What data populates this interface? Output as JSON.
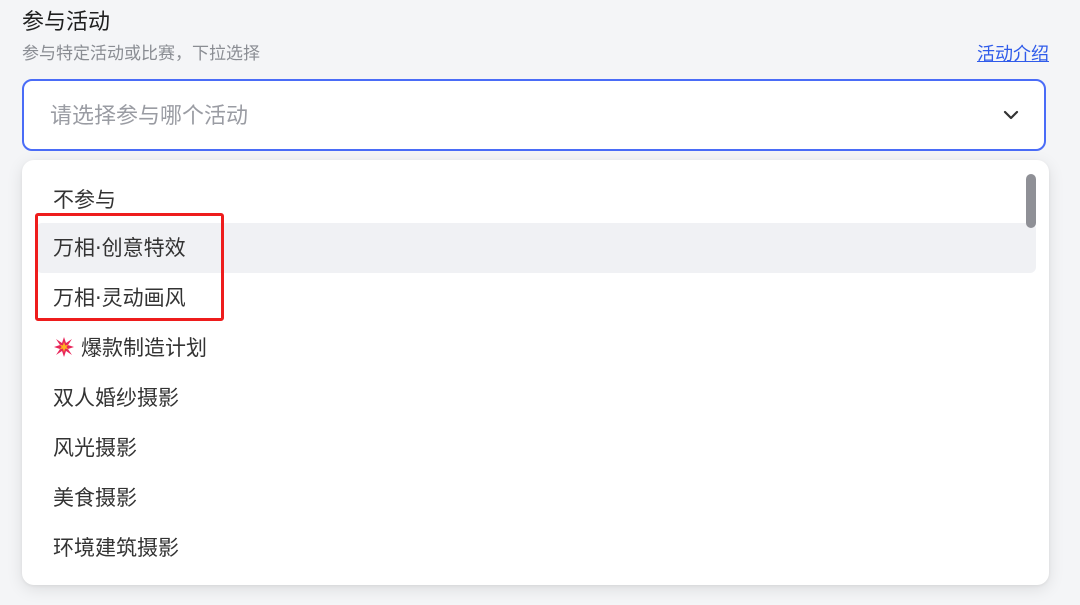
{
  "section": {
    "title": "参与活动",
    "subtitle": "参与特定活动或比赛，下拉选择",
    "link_label": "活动介绍"
  },
  "select": {
    "placeholder": "请选择参与哪个活动",
    "icon": "chevron-down-icon"
  },
  "dropdown": {
    "options": [
      {
        "label": "不参与"
      },
      {
        "label": "万相·创意特效",
        "state": "hover"
      },
      {
        "label": "万相·灵动画风"
      },
      {
        "label": "爆款制造计划",
        "icon": "burst-icon"
      },
      {
        "label": "双人婚纱摄影"
      },
      {
        "label": "风光摄影"
      },
      {
        "label": "美食摄影"
      },
      {
        "label": "环境建筑摄影"
      }
    ]
  },
  "annotation": {
    "color": "#ee1c1c"
  },
  "colors": {
    "accent": "#4a6cf7",
    "link": "#2f5bea",
    "hover_bg": "#f0f1f4"
  }
}
